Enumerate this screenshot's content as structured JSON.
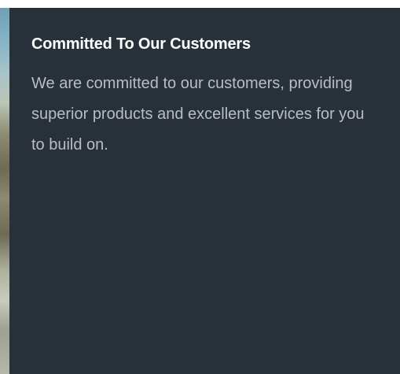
{
  "card": {
    "title": "Committed To Our Customers",
    "body": "We are committed to our customers, providing superior products and excellent services for you to build on."
  },
  "colors": {
    "card_background": "#283039",
    "title_text": "#ffffff",
    "body_text": "#b9bec6"
  }
}
